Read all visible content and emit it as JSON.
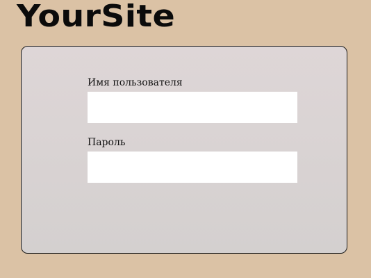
{
  "site": {
    "logo_text": "YourSite"
  },
  "login_form": {
    "username": {
      "label": "Имя пользователя",
      "value": "",
      "placeholder": ""
    },
    "password": {
      "label": "Пароль",
      "value": "",
      "placeholder": ""
    }
  },
  "colors": {
    "page_background": "#dbc2a5",
    "panel_background": "#d8d3d3",
    "input_background": "#ffffff",
    "text": "#111111"
  }
}
